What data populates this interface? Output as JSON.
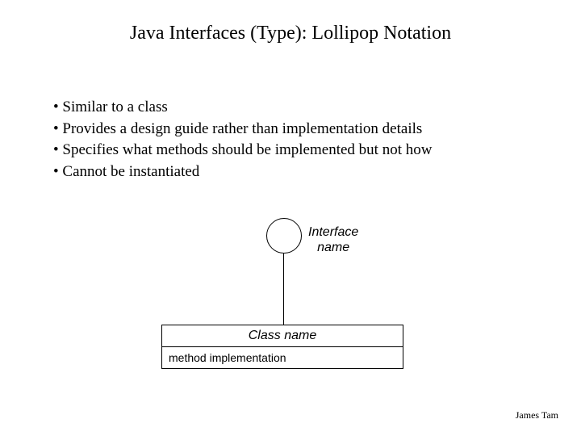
{
  "title": "Java Interfaces (Type): Lollipop Notation",
  "bullets": [
    "Similar to a class",
    "Provides a design guide rather than implementation details",
    "Specifies what methods should be implemented but not how",
    "Cannot be instantiated"
  ],
  "diagram": {
    "interface_label_line1": "Interface",
    "interface_label_line2": "name",
    "class_name": "Class name",
    "method_text": "method implementation"
  },
  "footer": "James Tam"
}
